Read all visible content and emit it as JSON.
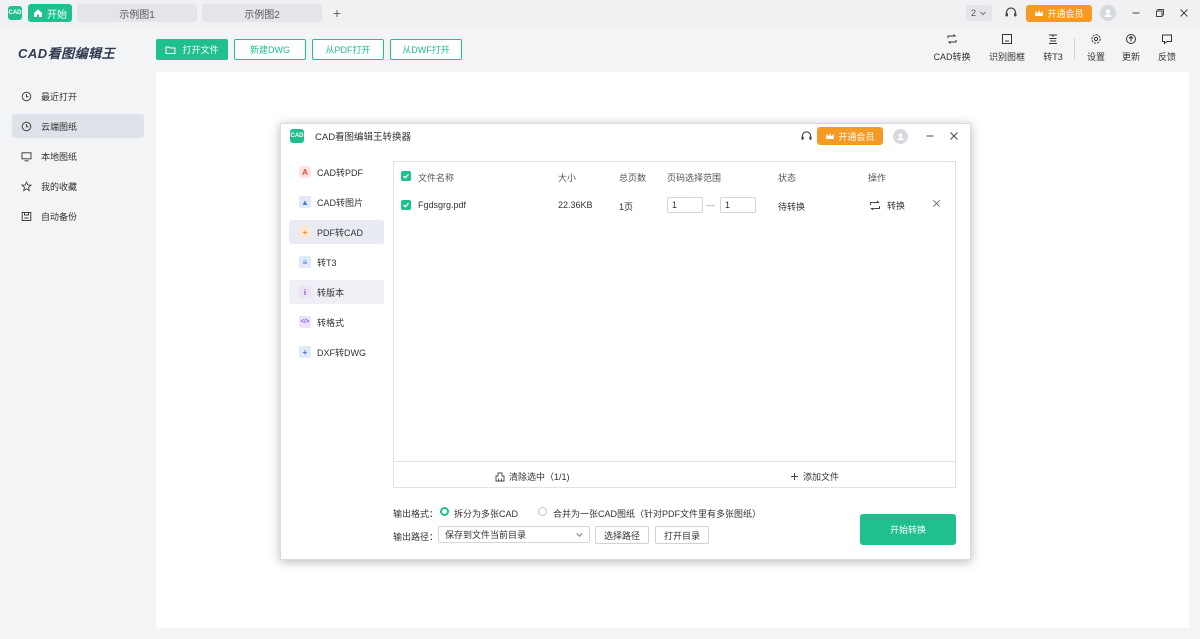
{
  "titlebar": {
    "app_icon_text": "CAD",
    "tabs": [
      {
        "label": "开始"
      },
      {
        "label": "示例图1"
      },
      {
        "label": "示例图2"
      }
    ],
    "add_tab": "+",
    "count_badge": "2",
    "vip_label": "开通会员"
  },
  "header": {
    "brand": "CAD看图编辑王",
    "buttons": {
      "open_file": "打开文件",
      "new_dwg": "新建DWG",
      "from_pdf": "从PDF打开",
      "from_dwf": "从DWF打开"
    },
    "tools": {
      "cad_convert": "CAD转换",
      "detect_frame": "识别图框",
      "to_t3": "转T3",
      "settings": "设置",
      "update": "更新",
      "feedback": "反馈"
    }
  },
  "sidebar": {
    "items": [
      {
        "label": "最近打开"
      },
      {
        "label": "云端图纸"
      },
      {
        "label": "本地图纸"
      },
      {
        "label": "我的收藏"
      },
      {
        "label": "自动备份"
      }
    ]
  },
  "dialog": {
    "icon_text": "CAD",
    "title": "CAD看图编辑王转换器",
    "vip_label": "开通会员",
    "menu": [
      {
        "label": "CAD转PDF"
      },
      {
        "label": "CAD转图片"
      },
      {
        "label": "PDF转CAD"
      },
      {
        "label": "转T3"
      },
      {
        "label": "转版本"
      },
      {
        "label": "转格式"
      },
      {
        "label": "DXF转DWG"
      }
    ],
    "table": {
      "headers": {
        "name": "文件名称",
        "size": "大小",
        "pages": "总页数",
        "range": "页码选择范围",
        "status": "状态",
        "action": "操作"
      },
      "rows": [
        {
          "name": "Fgdsgrg.pdf",
          "size": "22.36KB",
          "pages": "1页",
          "range_from": "1",
          "range_sep": "—",
          "range_to": "1",
          "status": "待转换",
          "action": "转换"
        }
      ]
    },
    "footer": {
      "clear": "清除选中（1/1)",
      "add": "添加文件"
    },
    "output_format_label": "输出格式：",
    "format_option_split": "拆分为多张CAD",
    "format_option_merge": "合并为一张CAD图纸（针对PDF文件里有多张图纸）",
    "output_path_label": "输出路径：",
    "output_path_value": "保存到文件当前目录",
    "choose_path": "选择路径",
    "open_dir": "打开目录",
    "start": "开始转换"
  }
}
